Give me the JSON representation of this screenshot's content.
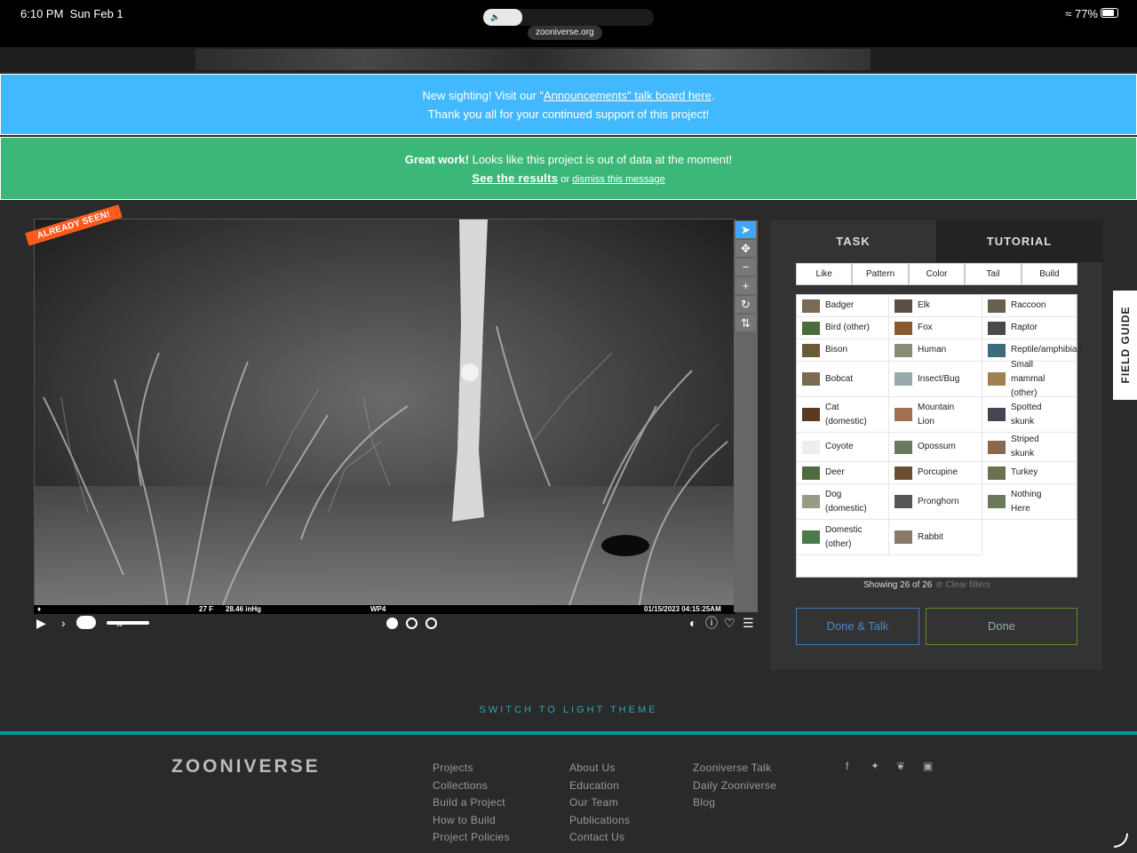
{
  "status": {
    "time": "6:10 PM",
    "date": "Sun Feb 1",
    "url": "zooniverse.org",
    "battery": "77%"
  },
  "banner_announce": {
    "line1_pre": "New sighting! Visit our \"",
    "link": "Announcements\" talk board here",
    "line1_post": ".",
    "line2": "Thank you all for your continued support of this project!"
  },
  "banner_done": {
    "bold": "Great work!",
    "text": " Looks like this project is out of data at the moment!",
    "results_link": "See the results",
    "or": " or ",
    "dismiss_link": "dismiss this message"
  },
  "subject": {
    "ribbon": "ALREADY SEEN!",
    "temp": "27 F",
    "pressure": "28.46 inHg",
    "camera": "WP4",
    "datetime": "01/15/2023  04:15:25AM"
  },
  "task": {
    "tab_task": "TASK",
    "tab_tutorial": "TUTORIAL",
    "filters": [
      "Like",
      "Pattern",
      "Color",
      "Tail",
      "Build"
    ],
    "choices": [
      "Badger",
      "Elk",
      "Raccoon",
      "Bird (other)",
      "Fox",
      "Raptor",
      "Bison",
      "Human",
      "Reptile/amphibian",
      "Bobcat",
      "Insect/Bug",
      "Small\nmammal\n(other)",
      "Cat\n(domestic)",
      "Mountain\nLion",
      "Spotted\nskunk",
      "Coyote",
      "Opossum",
      "Striped\nskunk",
      "Deer",
      "Porcupine",
      "Turkey",
      "Dog\n(domestic)",
      "Pronghorn",
      "Nothing\nHere",
      "Domestic\n(other)",
      "Rabbit"
    ],
    "showing": "Showing 26 of 26",
    "clear_filters": "Clear filters",
    "done_talk": "Done & Talk",
    "done": "Done"
  },
  "field_guide": "FIELD GUIDE",
  "theme_switch": "SWITCH TO LIGHT THEME",
  "footer": {
    "logo": "ZOONIVERSE",
    "col1": [
      "Projects",
      "Collections",
      "Build a Project",
      "How to Build",
      "Project Policies"
    ],
    "col2": [
      "About Us",
      "Education",
      "Our Team",
      "Publications",
      "Contact Us"
    ],
    "col3": [
      "Zooniverse Talk",
      "Daily Zooniverse",
      "Blog"
    ],
    "social_icons": [
      "facebook-icon",
      "twitter-icon",
      "bluesky-icon",
      "instagram-icon"
    ]
  }
}
